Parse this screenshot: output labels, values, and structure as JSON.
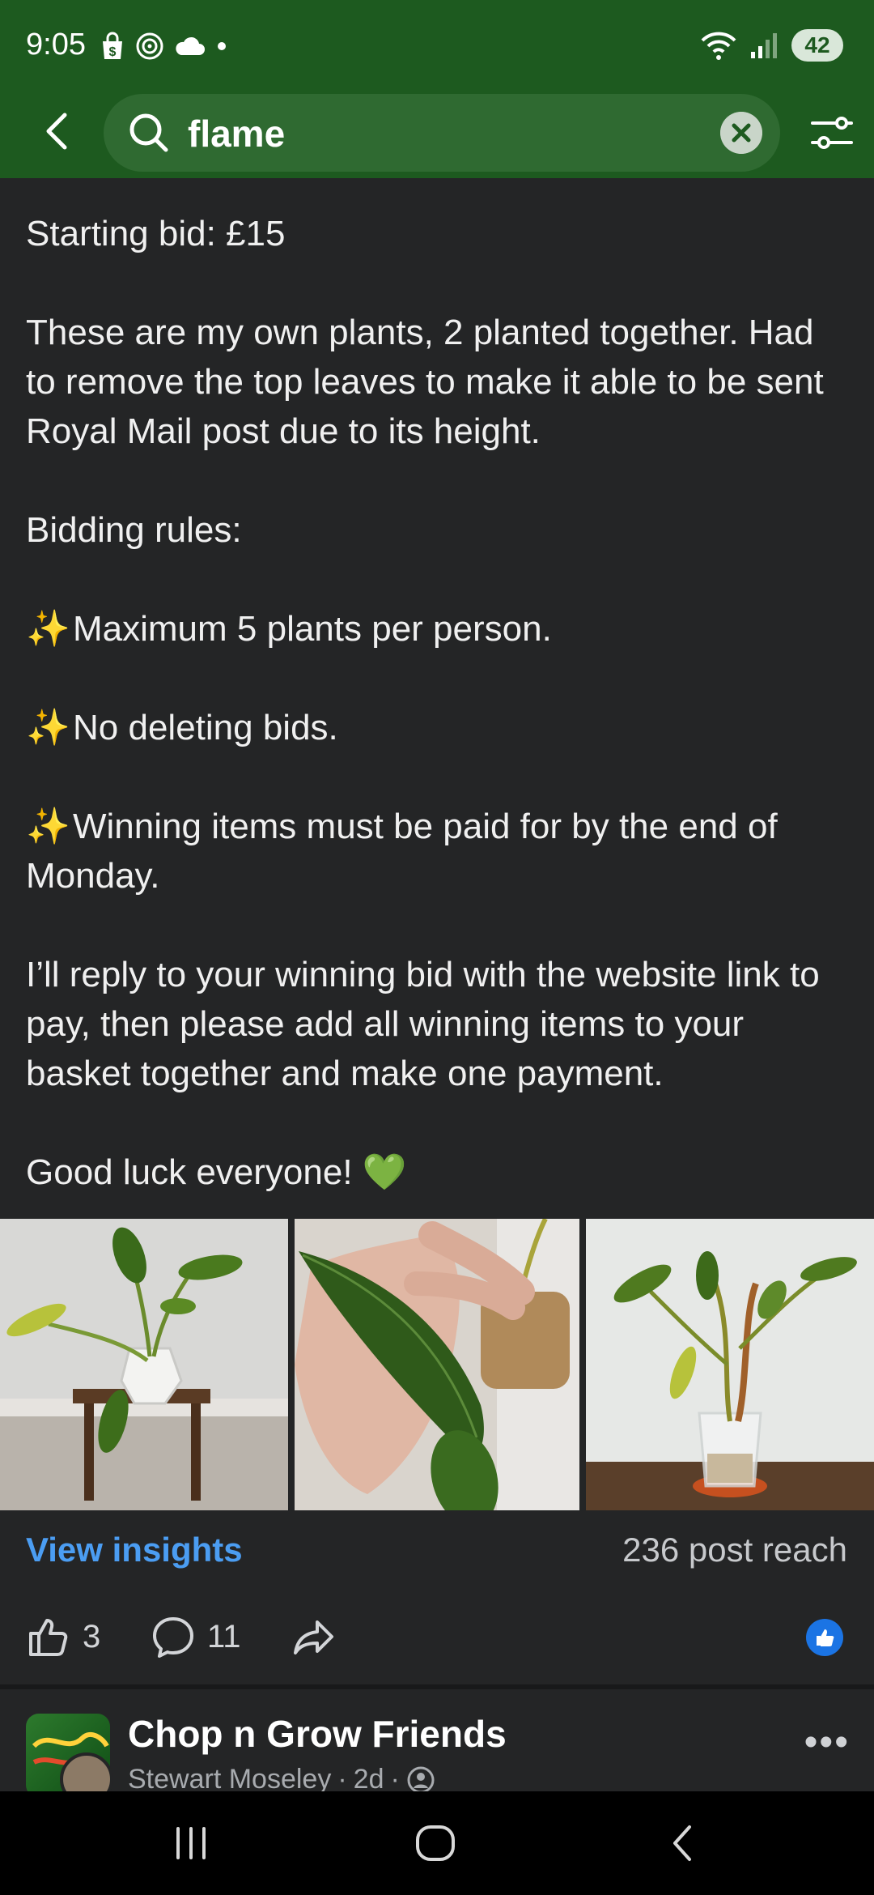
{
  "status_bar": {
    "time": "9:05",
    "battery": "42",
    "left_icons": [
      "shopping-bag-icon",
      "whatsapp-icon",
      "cloud-icon",
      "dot-icon"
    ],
    "right_icons": [
      "wifi-icon",
      "signal-icon",
      "battery-icon"
    ]
  },
  "search": {
    "query": "flame"
  },
  "post": {
    "paragraphs": [
      "Starting bid: £15",
      "These are my own plants, 2 planted together. Had to remove the top leaves to make it able to be sent Royal Mail post due to its height.",
      "Bidding rules:",
      "Maximum 5 plants per person.",
      "No deleting bids.",
      "Winning items must be paid for by the end of Monday.",
      "I’ll reply to your winning bid with the website link to pay, then please add all winning items to your basket together and make one payment.",
      "Good luck everyone! 💚"
    ],
    "sparkle": "✨",
    "photos": [
      "plant-on-stool",
      "leaf-in-hand",
      "plant-in-clear-pot"
    ],
    "insights_label": "View insights",
    "reach": "236 post reach",
    "likes": "3",
    "comments": "11"
  },
  "next_post": {
    "group_name": "Chop n Grow Friends",
    "author": "Stewart Moseley",
    "time": "2d",
    "separator": "·",
    "more": "•••"
  },
  "colors": {
    "header_green": "#1d5a1f",
    "background": "#242526",
    "link_blue": "#4b9df2",
    "like_blue": "#1b74e4"
  }
}
